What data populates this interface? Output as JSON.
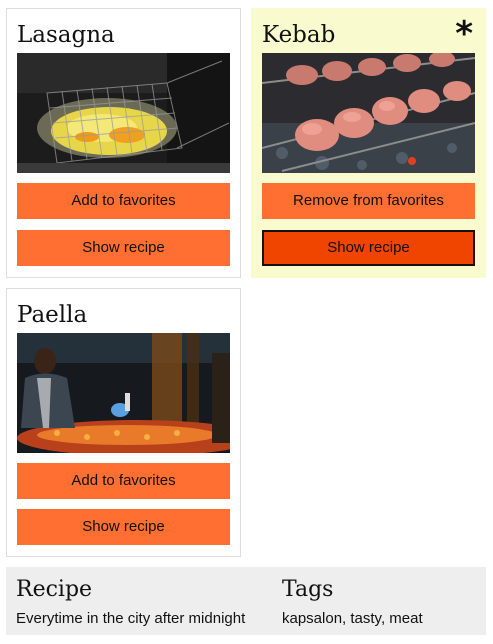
{
  "recipes": [
    {
      "title": "Lasagna",
      "image": "fryer-basket-photo",
      "favorite_label": "Add to favorites",
      "show_label": "Show recipe",
      "is_favorite": false
    },
    {
      "title": "Kebab",
      "image": "meat-skewers-photo",
      "favorite_label": "Remove from favorites",
      "show_label": "Show recipe",
      "is_favorite": true,
      "favorite_marker": "*"
    },
    {
      "title": "Paella",
      "image": "chef-cooking-photo",
      "favorite_label": "Add to favorites",
      "show_label": "Show recipe",
      "is_favorite": false
    }
  ],
  "footer": {
    "recipe_heading": "Recipe",
    "recipe_text": "Everytime in the city after midnight",
    "tags_heading": "Tags",
    "tags_text": "kapsalon, tasty, meat"
  },
  "colors": {
    "button": "#ff6f31",
    "button_focused": "#ef4500",
    "favorite_card_bg": "#fafacf",
    "footer_bg": "#eeeeee"
  }
}
